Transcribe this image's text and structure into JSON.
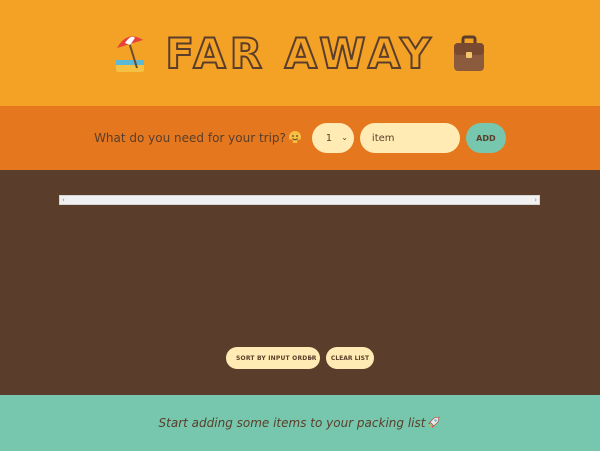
{
  "header": {
    "title": "FAR AWAY",
    "left_icon": "beach-umbrella-icon",
    "right_icon": "briefcase-icon"
  },
  "form": {
    "question": "What do you need for your trip?",
    "question_icon": "hugging-face-icon",
    "quantity_value": "1",
    "item_placeholder": "item",
    "add_label": "ADD"
  },
  "actions": {
    "sort_value": "SORT BY INPUT ORDER",
    "clear_label": "CLEAR LIST"
  },
  "stats": {
    "text": "Start adding some items to your packing list",
    "icon": "rocket-icon"
  },
  "colors": {
    "header": "#f4a226",
    "form": "#e5771e",
    "list": "#5a3e2b",
    "stats": "#76c7ad",
    "input": "#ffebb3"
  }
}
